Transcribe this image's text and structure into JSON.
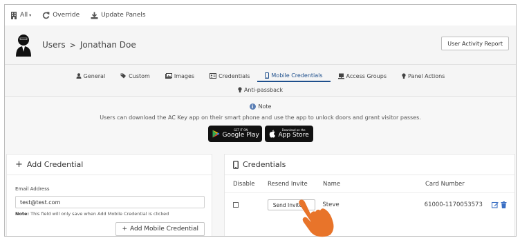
{
  "toolbar": {
    "all_label": "All",
    "override_label": "Override",
    "update_panels_label": "Update Panels"
  },
  "header": {
    "breadcrumb_root": "Users",
    "breadcrumb_separator": ">",
    "user_name": "Jonathan Doe",
    "report_button": "User Activity Report"
  },
  "tabs": {
    "row1": [
      {
        "label": "General",
        "icon": "user-icon"
      },
      {
        "label": "Custom",
        "icon": "tags-icon"
      },
      {
        "label": "Images",
        "icon": "images-icon"
      },
      {
        "label": "Credentials",
        "icon": "id-card-icon"
      },
      {
        "label": "Mobile Credentials",
        "icon": "mobile-icon",
        "active": true
      },
      {
        "label": "Access Groups",
        "icon": "access-groups-icon"
      },
      {
        "label": "Panel Actions",
        "icon": "bulb-icon"
      }
    ],
    "row2": [
      {
        "label": "Anti-passback",
        "icon": "bulb-icon"
      }
    ]
  },
  "note": {
    "title": "Note",
    "text": "Users can download the AC Key app on their smart phone and use the app to unlock doors and grant visitor passes.",
    "google_play": {
      "small": "GET IT ON",
      "big": "Google Play"
    },
    "app_store": {
      "small": "Download on the",
      "big": "App Store"
    }
  },
  "add_credential": {
    "title": "Add Credential",
    "email_label": "Email Address",
    "email_value": "test@test.com",
    "note_bold": "Note:",
    "note_text": " This field will only save when Add Mobile Credential is clicked",
    "button": "Add Mobile Credential"
  },
  "credentials": {
    "title": "Credentials",
    "columns": [
      "Disable",
      "Resend Invite",
      "Name",
      "Card Number"
    ],
    "rows": [
      {
        "disabled": false,
        "resend_label": "Send Invite",
        "name": "Steve",
        "card_number": "61000-1170053573"
      }
    ]
  },
  "colors": {
    "accent": "#1e4f8c",
    "icon_blue": "#3a6fc4",
    "hand": "#e8742a"
  }
}
